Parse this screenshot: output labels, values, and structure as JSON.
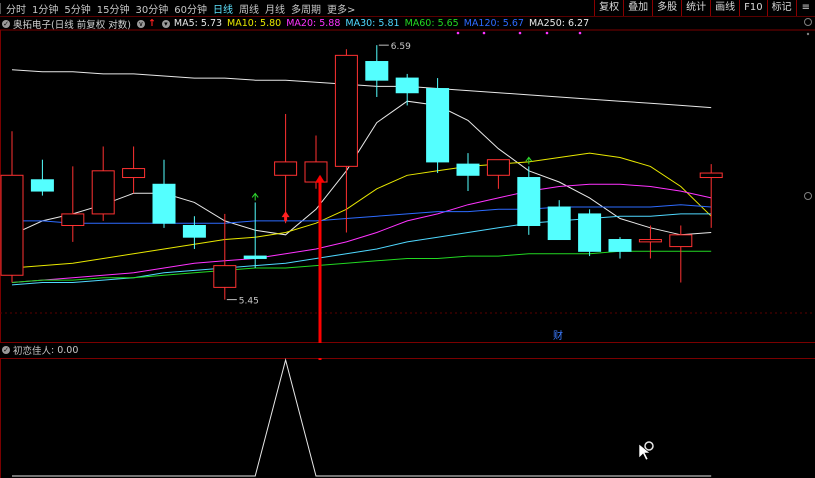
{
  "topbar": {
    "periods": [
      "分时",
      "1分钟",
      "5分钟",
      "15分钟",
      "30分钟",
      "60分钟",
      "日线",
      "周线",
      "月线",
      "多周期",
      "更多>"
    ],
    "active_period": "日线",
    "right_buttons": [
      "复权",
      "叠加",
      "多股",
      "统计",
      "画线",
      "F10",
      "标记"
    ]
  },
  "legend": {
    "stock_label": "奥拓电子(日线 前复权 对数)",
    "items": [
      {
        "text": "MA5: 5.73",
        "color": "#e8e8e8"
      },
      {
        "text": "MA10: 5.80",
        "color": "#e8e800"
      },
      {
        "text": "MA20: 5.88",
        "color": "#ff33ff"
      },
      {
        "text": "MA30: 5.81",
        "color": "#4fd8ff"
      },
      {
        "text": "MA60: 5.65",
        "color": "#22d822"
      },
      {
        "text": "MA120: 5.67",
        "color": "#2d6bff"
      },
      {
        "text": "MA250: 6.27",
        "color": "#e8e8e8"
      }
    ]
  },
  "sub_indicator": {
    "label": "初恋佳人",
    "value": ": 0.00"
  },
  "annotations": {
    "high_label": "6.59",
    "low_label": "5.45",
    "event_label": "财"
  },
  "colors": {
    "up": "#ff3232",
    "down": "#54ffff",
    "signal": "#ff0000",
    "frame": "#7a0000",
    "grid": "#5a0000"
  },
  "chart_data": {
    "type": "candlestick",
    "title": "",
    "ylim": [
      5.3,
      6.66
    ],
    "candles": [
      {
        "o": 5.55,
        "c": 5.98,
        "h": 6.18,
        "l": 5.52
      },
      {
        "o": 5.96,
        "c": 5.91,
        "h": 6.05,
        "l": 5.89
      },
      {
        "o": 5.76,
        "c": 5.81,
        "h": 6.02,
        "l": 5.69
      },
      {
        "o": 5.81,
        "c": 6.0,
        "h": 6.11,
        "l": 5.78
      },
      {
        "o": 5.97,
        "c": 6.01,
        "h": 6.11,
        "l": 5.9
      },
      {
        "o": 5.94,
        "c": 5.77,
        "h": 6.05,
        "l": 5.75
      },
      {
        "o": 5.76,
        "c": 5.71,
        "h": 5.8,
        "l": 5.66
      },
      {
        "o": 5.5,
        "c": 5.59,
        "h": 5.81,
        "l": 5.45
      },
      {
        "o": 5.63,
        "c": 5.62,
        "h": 5.86,
        "l": 5.58
      },
      {
        "o": 5.98,
        "c": 6.04,
        "h": 6.26,
        "l": 5.77
      },
      {
        "o": 5.95,
        "c": 6.04,
        "h": 6.16,
        "l": 5.92
      },
      {
        "o": 6.02,
        "c": 6.54,
        "h": 6.57,
        "l": 5.73
      },
      {
        "o": 6.51,
        "c": 6.42,
        "h": 6.59,
        "l": 6.34
      },
      {
        "o": 6.43,
        "c": 6.36,
        "h": 6.45,
        "l": 6.3
      },
      {
        "o": 6.38,
        "c": 6.04,
        "h": 6.43,
        "l": 5.99
      },
      {
        "o": 6.03,
        "c": 5.98,
        "h": 6.08,
        "l": 5.91
      },
      {
        "o": 5.98,
        "c": 6.05,
        "h": 6.05,
        "l": 5.92
      },
      {
        "o": 5.97,
        "c": 5.76,
        "h": 6.02,
        "l": 5.72
      },
      {
        "o": 5.84,
        "c": 5.7,
        "h": 5.87,
        "l": 5.7
      },
      {
        "o": 5.81,
        "c": 5.65,
        "h": 5.83,
        "l": 5.63
      },
      {
        "o": 5.7,
        "c": 5.65,
        "h": 5.71,
        "l": 5.62
      },
      {
        "o": 5.69,
        "c": 5.7,
        "h": 5.76,
        "l": 5.62
      },
      {
        "o": 5.67,
        "c": 5.72,
        "h": 5.76,
        "l": 5.52
      },
      {
        "o": 5.97,
        "c": 5.99,
        "h": 6.03,
        "l": 5.75
      }
    ],
    "ma_series": [
      {
        "name": "MA5",
        "color": "#e8e8e8",
        "values": [
          5.72,
          5.78,
          5.81,
          5.85,
          5.9,
          5.9,
          5.86,
          5.78,
          5.74,
          5.72,
          5.83,
          6.0,
          6.22,
          6.32,
          6.3,
          6.23,
          6.1,
          6.0,
          5.95,
          5.88,
          5.79,
          5.75,
          5.72,
          5.73
        ]
      },
      {
        "name": "MA10",
        "color": "#e8e800",
        "values": [
          5.58,
          5.59,
          5.6,
          5.62,
          5.64,
          5.66,
          5.68,
          5.7,
          5.71,
          5.73,
          5.77,
          5.83,
          5.92,
          5.98,
          6.0,
          6.02,
          6.03,
          6.04,
          6.06,
          6.08,
          6.06,
          6.02,
          5.93,
          5.8
        ]
      },
      {
        "name": "MA20",
        "color": "#ff33ff",
        "values": [
          5.52,
          5.53,
          5.54,
          5.55,
          5.56,
          5.58,
          5.6,
          5.61,
          5.62,
          5.64,
          5.66,
          5.69,
          5.73,
          5.78,
          5.81,
          5.85,
          5.88,
          5.91,
          5.93,
          5.94,
          5.94,
          5.93,
          5.91,
          5.88
        ]
      },
      {
        "name": "MA30",
        "color": "#4fd8ff",
        "values": [
          5.51,
          5.52,
          5.52,
          5.53,
          5.54,
          5.56,
          5.57,
          5.58,
          5.59,
          5.6,
          5.62,
          5.64,
          5.66,
          5.69,
          5.71,
          5.73,
          5.75,
          5.77,
          5.78,
          5.79,
          5.8,
          5.8,
          5.81,
          5.81
        ]
      },
      {
        "name": "MA60",
        "color": "#22d822",
        "values": [
          5.52,
          5.53,
          5.53,
          5.54,
          5.54,
          5.55,
          5.56,
          5.57,
          5.58,
          5.58,
          5.59,
          5.6,
          5.61,
          5.62,
          5.62,
          5.63,
          5.63,
          5.64,
          5.64,
          5.64,
          5.65,
          5.65,
          5.65,
          5.65
        ]
      },
      {
        "name": "MA120",
        "color": "#2d6bff",
        "values": [
          5.78,
          5.78,
          5.77,
          5.77,
          5.77,
          5.77,
          5.77,
          5.77,
          5.78,
          5.78,
          5.78,
          5.79,
          5.8,
          5.81,
          5.82,
          5.82,
          5.83,
          5.83,
          5.84,
          5.84,
          5.84,
          5.84,
          5.85,
          5.84
        ]
      },
      {
        "name": "MA250",
        "color": "#e8e8e8",
        "values": [
          6.47,
          6.46,
          6.46,
          6.45,
          6.45,
          6.44,
          6.43,
          6.43,
          6.42,
          6.42,
          6.41,
          6.4,
          6.39,
          6.39,
          6.38,
          6.37,
          6.36,
          6.35,
          6.34,
          6.33,
          6.32,
          6.31,
          6.3,
          6.29
        ]
      }
    ],
    "small_markers": [
      {
        "i": 8,
        "type": "up"
      },
      {
        "i": 17,
        "type": "up"
      }
    ],
    "buy_arrow_index": 9,
    "signal_index": 10,
    "sub_chart": {
      "values": [
        0,
        0,
        0,
        0,
        0,
        0,
        0,
        0,
        0,
        1,
        0,
        0,
        0,
        0,
        0,
        0,
        0,
        0,
        0,
        0,
        0,
        0,
        0,
        0
      ]
    }
  }
}
